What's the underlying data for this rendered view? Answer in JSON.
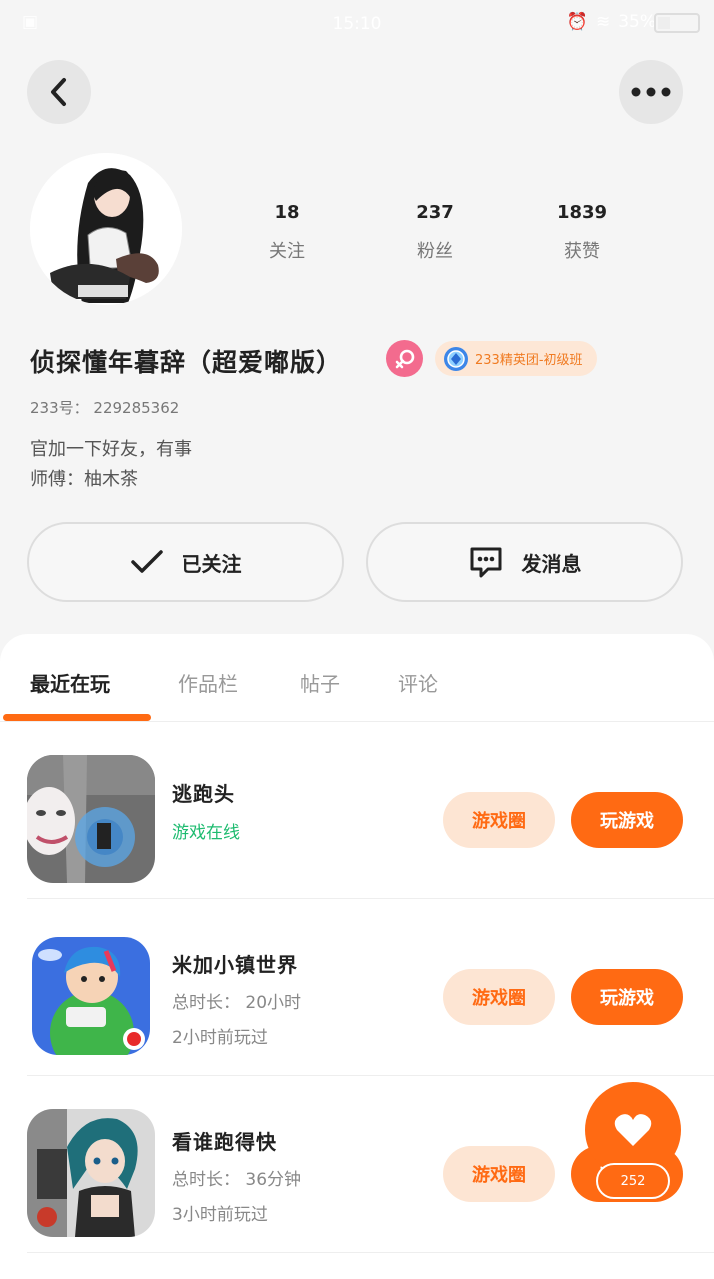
{
  "status_bar": {
    "time": "15:10",
    "battery_pct": "35%"
  },
  "profile": {
    "stats": [
      {
        "value": "18",
        "label": "关注"
      },
      {
        "value": "237",
        "label": "粉丝"
      },
      {
        "value": "1839",
        "label": "获赞"
      }
    ],
    "username": "侦探懂年暮辞（超爱嘟版）",
    "rank_badge": "233精英团-初级班",
    "uid_label": "233号：",
    "uid": "229285362",
    "bio_line1": "官加一下好友，有事",
    "bio_line2": "师傅：柚木茶"
  },
  "actions": {
    "follow_label": "已关注",
    "message_label": "发消息"
  },
  "tabs": [
    {
      "label": "最近在玩"
    },
    {
      "label": "作品栏"
    },
    {
      "label": "帖子"
    },
    {
      "label": "评论"
    }
  ],
  "games": [
    {
      "name": "逃跑头",
      "status": "游戏在线",
      "circle_label": "游戏圈",
      "play_label": "玩游戏"
    },
    {
      "name": "米加小镇世界",
      "duration": "总时长： 20小时",
      "last_played": "2小时前玩过",
      "circle_label": "游戏圈",
      "play_label": "玩游戏"
    },
    {
      "name": "看谁跑得快",
      "duration": "总时长： 36分钟",
      "last_played": "3小时前玩过",
      "circle_label": "游戏圈",
      "play_label": "玩游戏"
    }
  ],
  "like": {
    "count": "252"
  },
  "colors": {
    "accent": "#ff6a13",
    "accent_light": "#fde5d3",
    "online": "#1dbb6f",
    "female": "#f36b8e"
  }
}
